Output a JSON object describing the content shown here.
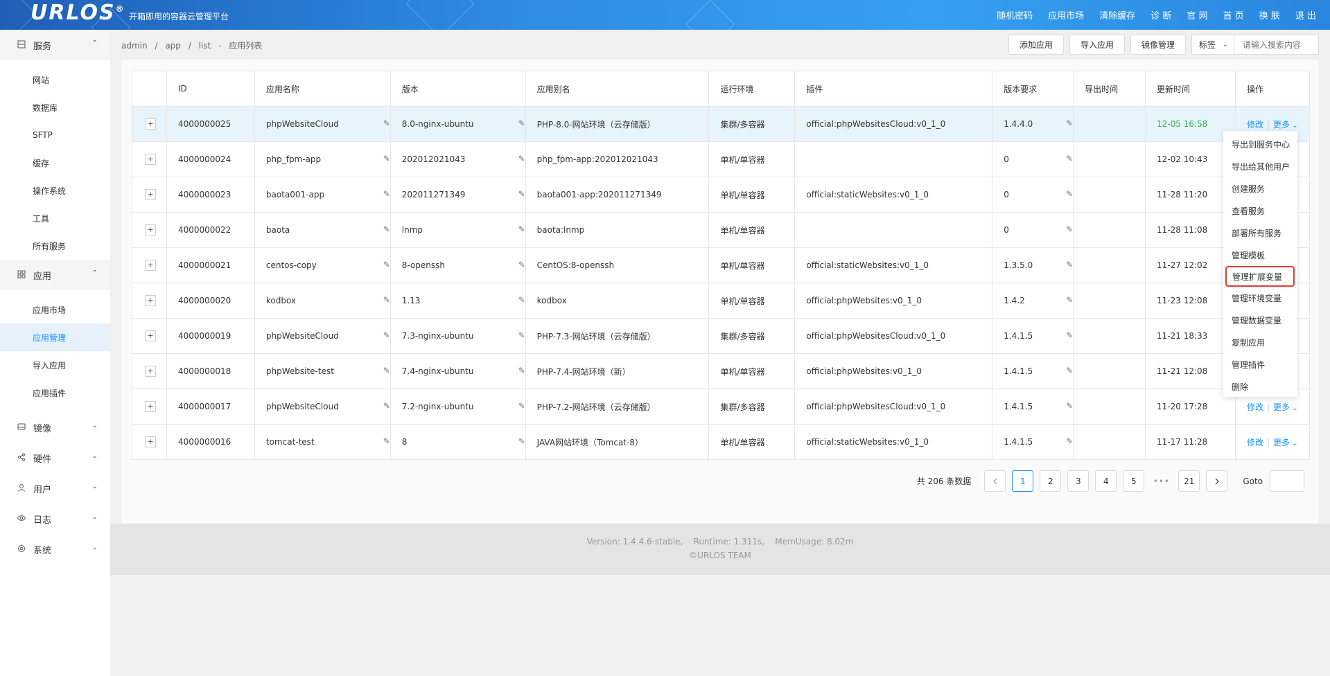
{
  "header": {
    "logo": "URLOS",
    "logo_mark": "®",
    "slogan": "开箱即用的容器云管理平台",
    "nav": [
      "随机密码",
      "应用市场",
      "清除缓存",
      "诊 断",
      "官 网",
      "首 页",
      "换 肤",
      "退 出"
    ]
  },
  "sidebar": {
    "groups": [
      {
        "label": "服务",
        "icon": "server-icon",
        "expanded": true,
        "items": [
          "网站",
          "数据库",
          "SFTP",
          "缓存",
          "操作系统",
          "工具",
          "所有服务"
        ]
      },
      {
        "label": "应用",
        "icon": "apps-icon",
        "expanded": true,
        "items": [
          "应用市场",
          "应用管理",
          "导入应用",
          "应用插件"
        ],
        "active_item": "应用管理"
      },
      {
        "label": "镜像",
        "icon": "disk-icon",
        "expanded": false
      },
      {
        "label": "硬件",
        "icon": "share-icon",
        "expanded": false
      },
      {
        "label": "用户",
        "icon": "user-icon",
        "expanded": false
      },
      {
        "label": "日志",
        "icon": "eye-icon",
        "expanded": false
      },
      {
        "label": "系统",
        "icon": "settings-icon",
        "expanded": false
      }
    ]
  },
  "breadcrumb": [
    "admin",
    "/",
    "app",
    "/",
    "list",
    "-",
    "应用列表"
  ],
  "toolbar": {
    "add_app": "添加应用",
    "import_app": "导入应用",
    "image_manage": "镜像管理",
    "tag_select": "标签",
    "search_placeholder": "请输入搜索内容"
  },
  "table": {
    "headers": [
      "",
      "ID",
      "应用名称",
      "版本",
      "应用别名",
      "运行环境",
      "插件",
      "版本要求",
      "导出时间",
      "更新时间",
      "操作"
    ],
    "rows": [
      {
        "id": "4000000025",
        "name": "phpWebsiteCloud",
        "version": "8.0-nginx-ubuntu",
        "alias": "PHP-8.0-网站环境（云存储版）",
        "env": "集群/多容器",
        "plugin": "official:phpWebsitesCloud:v0_1_0",
        "req": "1.4.4.0",
        "export": "",
        "updated": "12-05 16:58"
      },
      {
        "id": "4000000024",
        "name": "php_fpm-app",
        "version": "202012021043",
        "alias": "php_fpm-app:202012021043",
        "env": "单机/单容器",
        "plugin": "",
        "req": "0",
        "export": "",
        "updated": "12-02 10:43"
      },
      {
        "id": "4000000023",
        "name": "baota001-app",
        "version": "202011271349",
        "alias": "baota001-app:202011271349",
        "env": "单机/单容器",
        "plugin": "official:staticWebsites:v0_1_0",
        "req": "0",
        "export": "",
        "updated": "11-28 11:20"
      },
      {
        "id": "4000000022",
        "name": "baota",
        "version": "lnmp",
        "alias": "baota:lnmp",
        "env": "单机/单容器",
        "plugin": "",
        "req": "0",
        "export": "",
        "updated": "11-28 11:08"
      },
      {
        "id": "4000000021",
        "name": "centos-copy",
        "version": "8-openssh",
        "alias": "CentOS:8-openssh",
        "env": "单机/单容器",
        "plugin": "official:staticWebsites:v0_1_0",
        "req": "1.3.5.0",
        "export": "",
        "updated": "11-27 12:02"
      },
      {
        "id": "4000000020",
        "name": "kodbox",
        "version": "1.13",
        "alias": "kodbox",
        "env": "单机/单容器",
        "plugin": "official:phpWebsites:v0_1_0",
        "req": "1.4.2",
        "export": "",
        "updated": "11-23 12:08"
      },
      {
        "id": "4000000019",
        "name": "phpWebsiteCloud",
        "version": "7.3-nginx-ubuntu",
        "alias": "PHP-7.3-网站环境（云存储版）",
        "env": "集群/多容器",
        "plugin": "official:phpWebsitesCloud:v0_1_0",
        "req": "1.4.1.5",
        "export": "",
        "updated": "11-21 18:33"
      },
      {
        "id": "4000000018",
        "name": "phpWebsite-test",
        "version": "7.4-nginx-ubuntu",
        "alias": "PHP-7.4-网站环境（新）",
        "env": "单机/单容器",
        "plugin": "official:phpWebsites:v0_1_0",
        "req": "1.4.1.5",
        "export": "",
        "updated": "11-21 12:08"
      },
      {
        "id": "4000000017",
        "name": "phpWebsiteCloud",
        "version": "7.2-nginx-ubuntu",
        "alias": "PHP-7.2-网站环境（云存储版）",
        "env": "集群/多容器",
        "plugin": "official:phpWebsitesCloud:v0_1_0",
        "req": "1.4.1.5",
        "export": "",
        "updated": "11-20 17:28"
      },
      {
        "id": "4000000016",
        "name": "tomcat-test",
        "version": "8",
        "alias": "JAVA网站环境（Tomcat-8）",
        "env": "单机/单容器",
        "plugin": "official:staticWebsites:v0_1_0",
        "req": "1.4.1.5",
        "export": "",
        "updated": "11-17 11:28"
      }
    ],
    "action_edit": "修改",
    "action_more": "更多",
    "rows_with_actions": [
      0,
      8,
      9
    ]
  },
  "dropdown": {
    "items": [
      "导出到服务中心",
      "导出给其他用户",
      "创建服务",
      "查看服务",
      "部署所有服务",
      "管理模板",
      "管理扩展变量",
      "管理环境变量",
      "管理数据变量",
      "复制应用",
      "管理插件",
      "删除"
    ],
    "highlighted": "管理扩展变量"
  },
  "pagination": {
    "total_text": "共 206 条数据",
    "pages": [
      "1",
      "2",
      "3",
      "4",
      "5"
    ],
    "ellipsis": "•••",
    "last_page": "21",
    "current": "1",
    "goto_label": "Goto"
  },
  "footer": {
    "line1": "Version: 1.4.4.6-stable,    Runtime: 1.311s,    MemUsage: 8.02m",
    "line2": "©URLOS TEAM"
  },
  "colors": {
    "header_blue": "#2f8de4",
    "accent": "#1890ff",
    "active_bg": "#e6f1fc",
    "green": "#2db34a",
    "highlight_red": "#e53935"
  }
}
